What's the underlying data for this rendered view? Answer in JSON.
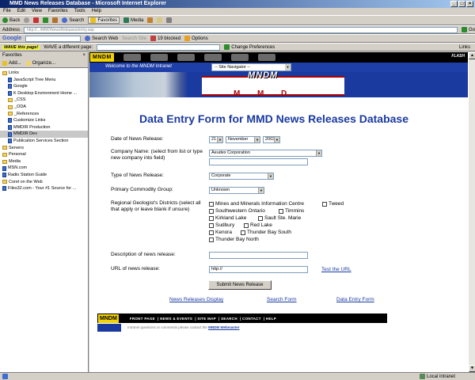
{
  "window": {
    "title": "MMD News Releases Database - Microsoft Internet Explorer",
    "min": "_",
    "max": "□",
    "close": "×"
  },
  "menu": [
    "File",
    "Edit",
    "View",
    "Favorites",
    "Tools",
    "Help"
  ],
  "toolbar": {
    "back": "Back",
    "search": "Search",
    "favorites": "Favorites",
    "media": "Media"
  },
  "address": {
    "label": "Address",
    "value": "http://.../MMDNewsReleases/entry.asp",
    "go": "Go"
  },
  "google": {
    "brand": "Google",
    "search_web": "Search Web",
    "search_site": "Search Site",
    "blocked": "19 blocked",
    "options": "Options"
  },
  "wave": {
    "this_page": "WAVE this page!",
    "different": "WAVE a different page:",
    "change_prefs": "Change Preferences",
    "links": "Links"
  },
  "sidebar": {
    "title": "Favorites",
    "add": "Add...",
    "organize": "Organize...",
    "items": [
      {
        "label": "Links",
        "kind": "folder",
        "sel": false
      },
      {
        "label": "JavaScript Tree Menu",
        "kind": "page",
        "sel": false
      },
      {
        "label": "Google",
        "kind": "page",
        "sel": false
      },
      {
        "label": "K Desktop Environment Home ...",
        "kind": "page",
        "sel": false
      },
      {
        "label": "_CSS",
        "kind": "folder",
        "sel": false
      },
      {
        "label": "_ODA",
        "kind": "folder",
        "sel": false
      },
      {
        "label": "_References",
        "kind": "folder",
        "sel": false
      },
      {
        "label": "Customize Links",
        "kind": "page",
        "sel": false
      },
      {
        "label": "MMDIR Production",
        "kind": "page",
        "sel": false
      },
      {
        "label": "MMDIR Dev",
        "kind": "page",
        "sel": true
      },
      {
        "label": "Publication Services Section",
        "kind": "page",
        "sel": false
      },
      {
        "label": "Servers",
        "kind": "folder",
        "sel": false
      },
      {
        "label": "Personal",
        "kind": "folder",
        "sel": false
      },
      {
        "label": "Media",
        "kind": "folder",
        "sel": false
      },
      {
        "label": "MSN.com",
        "kind": "page",
        "sel": false
      },
      {
        "label": "Radio Station Guide",
        "kind": "page",
        "sel": false
      },
      {
        "label": "Corel on the Web",
        "kind": "folder",
        "sel": false
      },
      {
        "label": "Files32.com - Your #1 Source for ...",
        "kind": "page",
        "sel": false
      }
    ]
  },
  "site": {
    "logo": "MNDM",
    "flash": "FLASH",
    "welcome": "Welcome to the MNDM Intranet",
    "site_nav": "-- Site Navigator --",
    "banner_big": "MNDM",
    "banner_letters": [
      "M",
      "M",
      "D"
    ]
  },
  "form": {
    "title": "Data Entry Form for MMD News Releases Database",
    "date_label": "Date of News Release:",
    "day": "21",
    "month": "November",
    "year": "2003",
    "company_label": "Company Name: (select from list or type new company into field)",
    "company_value": "Aeudex Corporation",
    "type_label": "Type of News Release:",
    "type_value": "Corporate",
    "commodity_label": "Primary Commodity Group:",
    "commodity_value": "Unknown",
    "districts_label": "Regional Geologist's Districts (select all that apply or leave blank if unsure)",
    "districts": [
      "Mines and Minerals Information Centre",
      "Tweed",
      "Southwestern Ontario",
      "Timmins",
      "Kirkland Lake",
      "Sault Ste. Marie",
      "Sudbury",
      "Red Lake",
      "Kenora",
      "Thunder Bay South",
      "Thunder Bay North"
    ],
    "description_label": "Description of news release:",
    "url_label": "URL of news release:",
    "url_value": "http://",
    "test_url": "Test the URL",
    "submit": "Submit News Release"
  },
  "links": {
    "display": "News Releases Display",
    "search": "Search Form",
    "entry": "Data Entry Form"
  },
  "footer": {
    "logo": "MNDM",
    "nav": [
      "FRONT PAGE",
      "NEWS & EVENTS",
      "SITE MAP",
      "SEARCH",
      "CONTACT",
      "HELP"
    ],
    "note": "Intranet questions or comments please contact the",
    "webmaster": "MNDM Webmaster"
  },
  "status": {
    "zone": "Local intranet"
  }
}
